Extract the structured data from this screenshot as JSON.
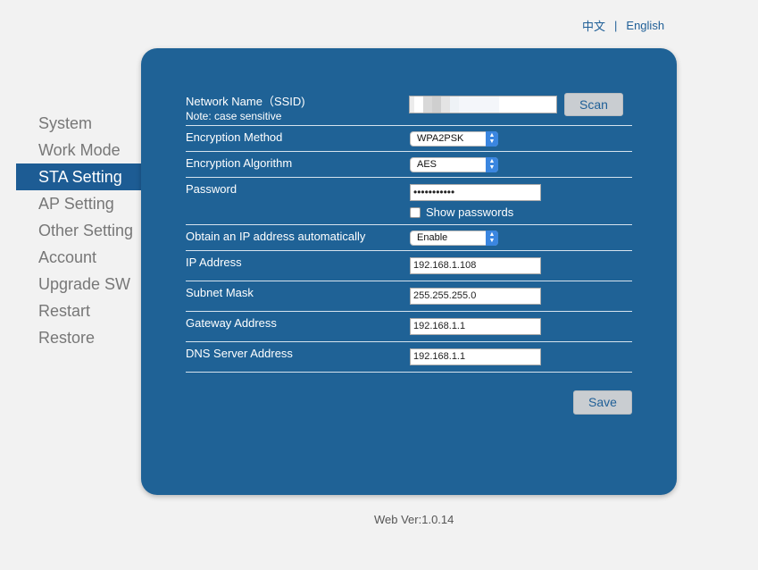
{
  "lang": {
    "chinese": "中文",
    "separator": "|",
    "english": "English"
  },
  "sidebar": {
    "items": [
      {
        "label": "System"
      },
      {
        "label": "Work Mode"
      },
      {
        "label": "STA Setting"
      },
      {
        "label": "AP Setting"
      },
      {
        "label": "Other Setting"
      },
      {
        "label": "Account"
      },
      {
        "label": "Upgrade SW"
      },
      {
        "label": "Restart"
      },
      {
        "label": "Restore"
      }
    ],
    "active": "STA Setting"
  },
  "form": {
    "ssid": {
      "label": "Network Name（SSID)",
      "note": "Note: case sensitive",
      "value": ""
    },
    "scan_label": "Scan",
    "encryption_method": {
      "label": "Encryption Method",
      "value": "WPA2PSK"
    },
    "encryption_algorithm": {
      "label": "Encryption Algorithm",
      "value": "AES"
    },
    "password": {
      "label": "Password",
      "value": "•••••••••••"
    },
    "show_passwords": {
      "label": "Show passwords",
      "checked": false
    },
    "dhcp": {
      "label": "Obtain an IP address automatically",
      "value": "Enable"
    },
    "ip_address": {
      "label": "IP Address",
      "value": "192.168.1.108"
    },
    "subnet_mask": {
      "label": "Subnet Mask",
      "value": "255.255.255.0"
    },
    "gateway": {
      "label": "Gateway Address",
      "value": "192.168.1.1"
    },
    "dns": {
      "label": "DNS Server Address",
      "value": "192.168.1.1"
    },
    "save_label": "Save"
  },
  "footer": {
    "version": "Web Ver:1.0.14"
  },
  "colors": {
    "panel": "#1f6296",
    "active_nav": "#1d5c94",
    "link": "#1f5f97",
    "button": "#c9cdd1"
  }
}
